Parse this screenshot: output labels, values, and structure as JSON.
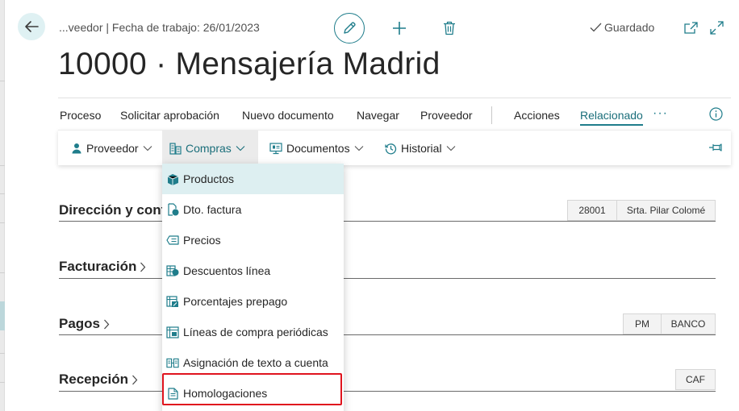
{
  "header": {
    "breadcrumb": "...veedor | Fecha de trabajo: 26/01/2023",
    "saved_label": "Guardado",
    "title": "10000 · Mensajería Madrid"
  },
  "action_bar": {
    "items": [
      "Proceso",
      "Solicitar aprobación",
      "Nuevo documento",
      "Navegar",
      "Proveedor"
    ],
    "acciones": "Acciones",
    "relacionado": "Relacionado",
    "more": "···"
  },
  "sub_ribbon": {
    "proveedor": "Proveedor",
    "compras": "Compras",
    "documentos": "Documentos",
    "historial": "Historial"
  },
  "sections": {
    "direccion": {
      "title": "Dirección y cont",
      "pills": [
        "28001",
        "Srta. Pilar Colomé"
      ]
    },
    "facturacion": {
      "title": "Facturación"
    },
    "pagos": {
      "title": "Pagos",
      "pills": [
        "PM",
        "BANCO"
      ]
    },
    "recepcion": {
      "title": "Recepción",
      "pills": [
        "CAF"
      ]
    }
  },
  "dropdown": {
    "items": [
      "Productos",
      "Dto. factura",
      "Precios",
      "Descuentos línea",
      "Porcentajes prepago",
      "Líneas de compra periódicas",
      "Asignación de texto a cuenta",
      "Homologaciones"
    ],
    "hovered_index": 0,
    "highlighted_index": 7
  },
  "colors": {
    "accent": "#1f7d8b",
    "hover": "#ddeff1",
    "highlight": "#e0141e"
  },
  "icons": {
    "back": "arrow-left-icon",
    "edit": "pencil-icon",
    "add": "plus-icon",
    "delete": "trash-icon",
    "saved": "check-icon",
    "popout": "open-in-new-window-icon",
    "expand": "expand-icon",
    "info": "info-icon",
    "pin": "pin-icon"
  }
}
